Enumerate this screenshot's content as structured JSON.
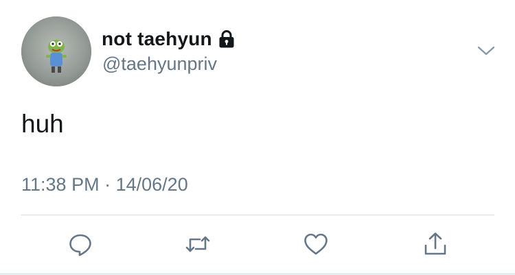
{
  "user": {
    "display_name": "not taehyun",
    "handle": "@taehyunpriv",
    "protected_icon": "lock-icon",
    "avatar_icon": "avatar-image"
  },
  "tweet": {
    "text": "huh",
    "time": "11:38 PM",
    "separator": "·",
    "date": "14/06/20"
  },
  "actions": [
    {
      "icon": "reply-icon"
    },
    {
      "icon": "retweet-icon"
    },
    {
      "icon": "like-icon"
    },
    {
      "icon": "share-icon"
    }
  ],
  "menu": {
    "icon": "chevron-down-icon"
  },
  "colors": {
    "text_primary": "#14171a",
    "text_secondary": "#657786",
    "icon_gray": "#657786",
    "divider": "#d6dadd"
  }
}
